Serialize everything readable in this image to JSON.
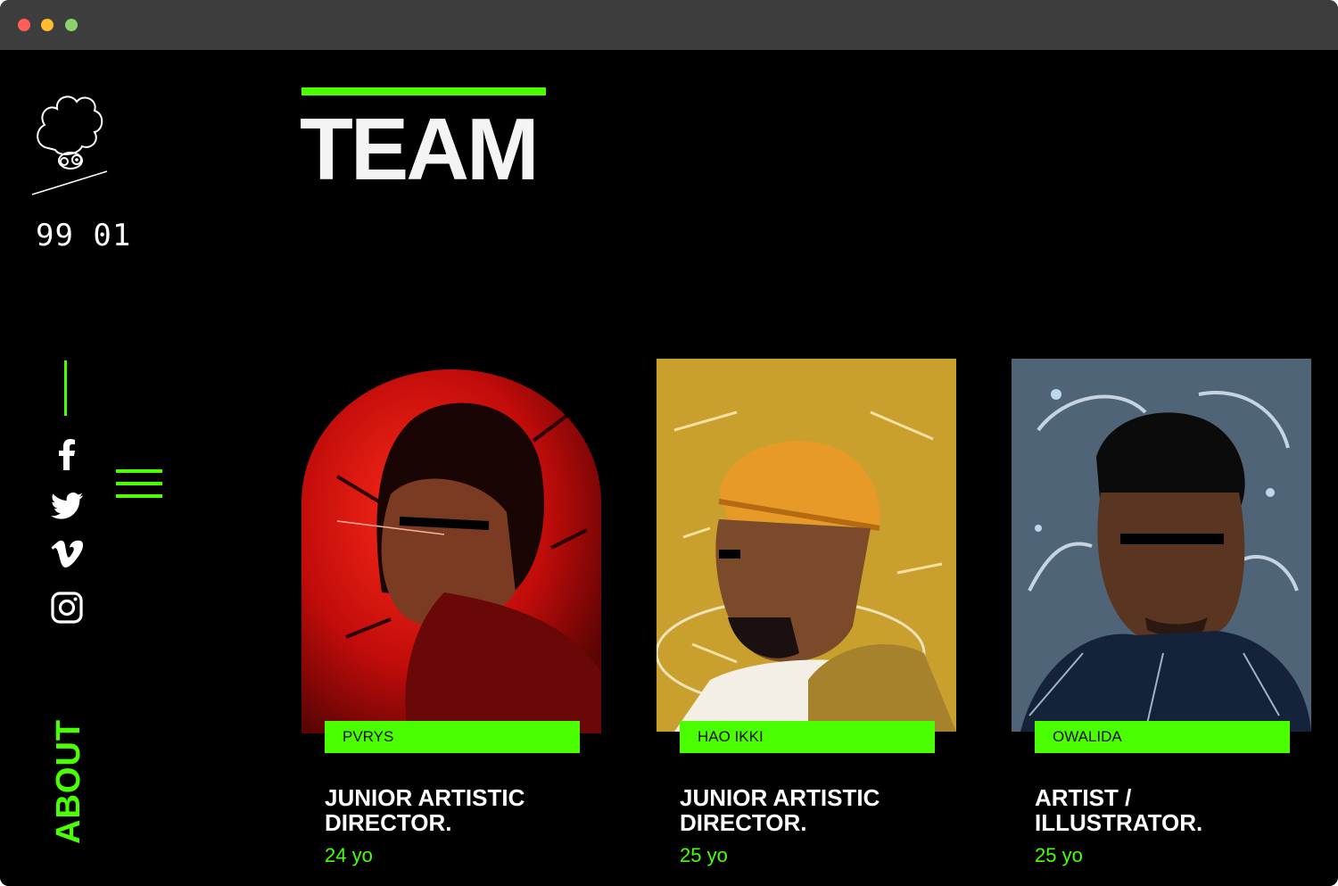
{
  "window": {
    "controls": [
      "close",
      "minimize",
      "maximize"
    ]
  },
  "brand": {
    "logo_text": "99 01",
    "logo_icon": "cloud-face-logo-icon"
  },
  "sidebar": {
    "social": [
      {
        "name": "facebook",
        "icon": "facebook-icon"
      },
      {
        "name": "twitter",
        "icon": "twitter-icon"
      },
      {
        "name": "vimeo",
        "icon": "vimeo-icon"
      },
      {
        "name": "instagram",
        "icon": "instagram-icon"
      }
    ],
    "menu_icon": "hamburger-menu-icon",
    "section_label": "ABOUT"
  },
  "page": {
    "title": "TEAM"
  },
  "team": [
    {
      "name": "PVRYS",
      "role_line1": "JUNIOR ARTISTIC",
      "role_line2": "DIRECTOR.",
      "age": "24 yo",
      "bg": "#c8100e"
    },
    {
      "name": "HAO IKKI",
      "role_line1": "JUNIOR ARTISTIC",
      "role_line2": "DIRECTOR.",
      "age": "25 yo",
      "bg": "#c9a02e"
    },
    {
      "name": "OWALIDA",
      "role_line1": "ARTIST /",
      "role_line2": "ILLUSTRATOR.",
      "age": "25 yo",
      "bg": "#4d6478"
    }
  ],
  "colors": {
    "accent": "#49ff00",
    "background": "#000000",
    "titlebar": "#3d3d3d"
  }
}
